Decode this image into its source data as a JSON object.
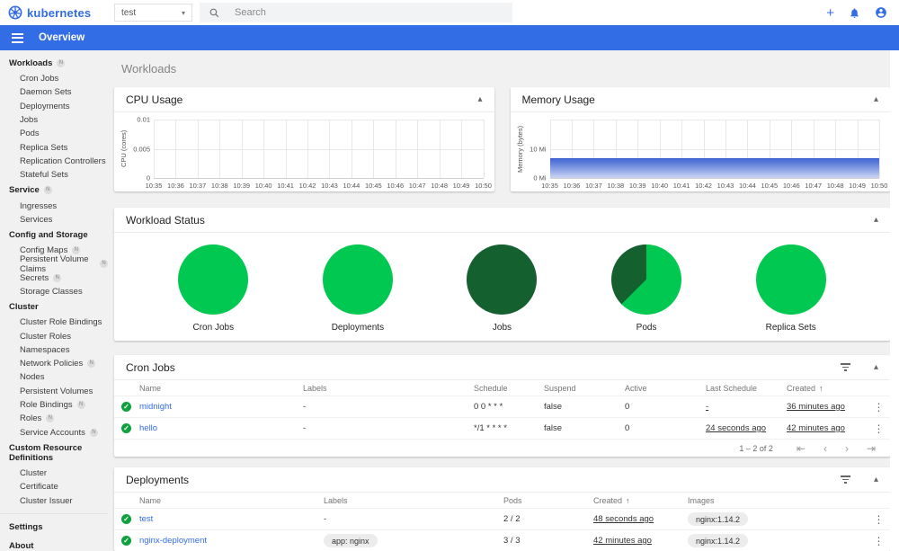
{
  "colors": {
    "accent_blue": "#326de6",
    "success_green": "#00c850",
    "dark_green": "#14602e",
    "status_check_green": "#0fa13e",
    "memory_area_blue": "#4568d4",
    "app_bar_bg": "#326de6",
    "page_bg": "#f1f1f1"
  },
  "header": {
    "logo_text": "kubernetes",
    "namespace_selector": {
      "value": "test"
    },
    "search": {
      "placeholder": "Search"
    },
    "action_icons": [
      "plus-icon",
      "notifications-bell-icon",
      "account-person-icon"
    ]
  },
  "app_bar": {
    "title": "Overview",
    "menu_icon": "hamburger-menu-icon"
  },
  "sidebar": {
    "sections": [
      {
        "label": "Workloads",
        "badge": "N",
        "items": [
          {
            "label": "Cron Jobs"
          },
          {
            "label": "Daemon Sets"
          },
          {
            "label": "Deployments"
          },
          {
            "label": "Jobs"
          },
          {
            "label": "Pods"
          },
          {
            "label": "Replica Sets"
          },
          {
            "label": "Replication Controllers"
          },
          {
            "label": "Stateful Sets"
          }
        ]
      },
      {
        "label": "Service",
        "badge": "N",
        "items": [
          {
            "label": "Ingresses"
          },
          {
            "label": "Services"
          }
        ]
      },
      {
        "label": "Config and Storage",
        "items": [
          {
            "label": "Config Maps",
            "badge": "N"
          },
          {
            "label": "Persistent Volume Claims",
            "badge": "N"
          },
          {
            "label": "Secrets",
            "badge": "N"
          },
          {
            "label": "Storage Classes"
          }
        ]
      },
      {
        "label": "Cluster",
        "items": [
          {
            "label": "Cluster Role Bindings"
          },
          {
            "label": "Cluster Roles"
          },
          {
            "label": "Namespaces"
          },
          {
            "label": "Network Policies",
            "badge": "N"
          },
          {
            "label": "Nodes"
          },
          {
            "label": "Persistent Volumes"
          },
          {
            "label": "Role Bindings",
            "badge": "N"
          },
          {
            "label": "Roles",
            "badge": "N"
          },
          {
            "label": "Service Accounts",
            "badge": "N"
          }
        ]
      },
      {
        "label": "Custom Resource Definitions",
        "items": [
          {
            "label": "Cluster"
          },
          {
            "label": "Certificate"
          },
          {
            "label": "Cluster Issuer"
          }
        ]
      }
    ],
    "footer_items": [
      {
        "label": "Settings"
      },
      {
        "label": "About"
      }
    ]
  },
  "page": {
    "title": "Workloads"
  },
  "chart_data": [
    {
      "type": "line",
      "title": "CPU Usage",
      "ylabel": "CPU (cores)",
      "yticks": [
        "0.01",
        "0.005",
        "0"
      ],
      "ylim": [
        0,
        0.01
      ],
      "xticks": [
        "10:35",
        "10:36",
        "10:37",
        "10:38",
        "10:39",
        "10:40",
        "10:41",
        "10:42",
        "10:43",
        "10:44",
        "10:45",
        "10:46",
        "10:47",
        "10:48",
        "10:49",
        "10:50"
      ],
      "series": [],
      "grid": true
    },
    {
      "type": "area",
      "title": "Memory Usage",
      "ylabel": "Memory (bytes)",
      "yticks": [
        "10 Mi",
        "0 Mi"
      ],
      "ylim_mi": [
        0,
        20
      ],
      "xticks": [
        "10:35",
        "10:36",
        "10:37",
        "10:38",
        "10:39",
        "10:40",
        "10:41",
        "10:42",
        "10:43",
        "10:44",
        "10:45",
        "10:46",
        "10:47",
        "10:48",
        "10:49",
        "10:50"
      ],
      "series": [
        {
          "name": "memory",
          "flat_value_mi": 6.7
        }
      ],
      "grid": true
    },
    {
      "type": "pie",
      "title": "Workload Status",
      "pies": [
        {
          "label": "Cron Jobs",
          "slices": [
            {
              "name": "succeeded",
              "color": "#00c850",
              "pct": 100
            }
          ]
        },
        {
          "label": "Deployments",
          "slices": [
            {
              "name": "succeeded",
              "color": "#00c850",
              "pct": 100
            }
          ]
        },
        {
          "label": "Jobs",
          "slices": [
            {
              "name": "running",
              "color": "#14602e",
              "pct": 100
            }
          ]
        },
        {
          "label": "Pods",
          "slices": [
            {
              "name": "succeeded",
              "color": "#00c850",
              "pct": 62.5
            },
            {
              "name": "running",
              "color": "#14602e",
              "pct": 37.5
            }
          ]
        },
        {
          "label": "Replica Sets",
          "slices": [
            {
              "name": "succeeded",
              "color": "#00c850",
              "pct": 100
            }
          ]
        }
      ]
    }
  ],
  "cpu_card": {
    "title": "CPU Usage"
  },
  "memory_card": {
    "title": "Memory Usage"
  },
  "status_card": {
    "title": "Workload Status"
  },
  "cron_jobs": {
    "title": "Cron Jobs",
    "columns": [
      "Name",
      "Labels",
      "Schedule",
      "Suspend",
      "Active",
      "Last Schedule",
      "Created"
    ],
    "sorted_column": "Created",
    "rows": [
      {
        "status": "ok",
        "name": "midnight",
        "labels": "-",
        "schedule": "0 0 * * *",
        "suspend": "false",
        "active": "0",
        "last_schedule": "-",
        "created": "36 minutes ago"
      },
      {
        "status": "ok",
        "name": "hello",
        "labels": "-",
        "schedule": "*/1 * * * *",
        "suspend": "false",
        "active": "0",
        "last_schedule": "24 seconds ago",
        "created": "42 minutes ago"
      }
    ],
    "pagination": {
      "range": "1 – 2 of 2",
      "controls": [
        "first-page",
        "previous-page",
        "next-page",
        "last-page"
      ]
    }
  },
  "deployments": {
    "title": "Deployments",
    "columns": [
      "Name",
      "Labels",
      "Pods",
      "Created",
      "Images"
    ],
    "sorted_column": "Created",
    "rows": [
      {
        "status": "ok",
        "name": "test",
        "labels": "-",
        "labels_is_chip": false,
        "pods": "2 / 2",
        "created": "48 seconds ago",
        "images": [
          "nginx:1.14.2"
        ]
      },
      {
        "status": "ok",
        "name": "nginx-deployment",
        "labels": "app: nginx",
        "labels_is_chip": true,
        "pods": "3 / 3",
        "created": "42 minutes ago",
        "images": [
          "nginx:1.14.2"
        ]
      }
    ]
  }
}
